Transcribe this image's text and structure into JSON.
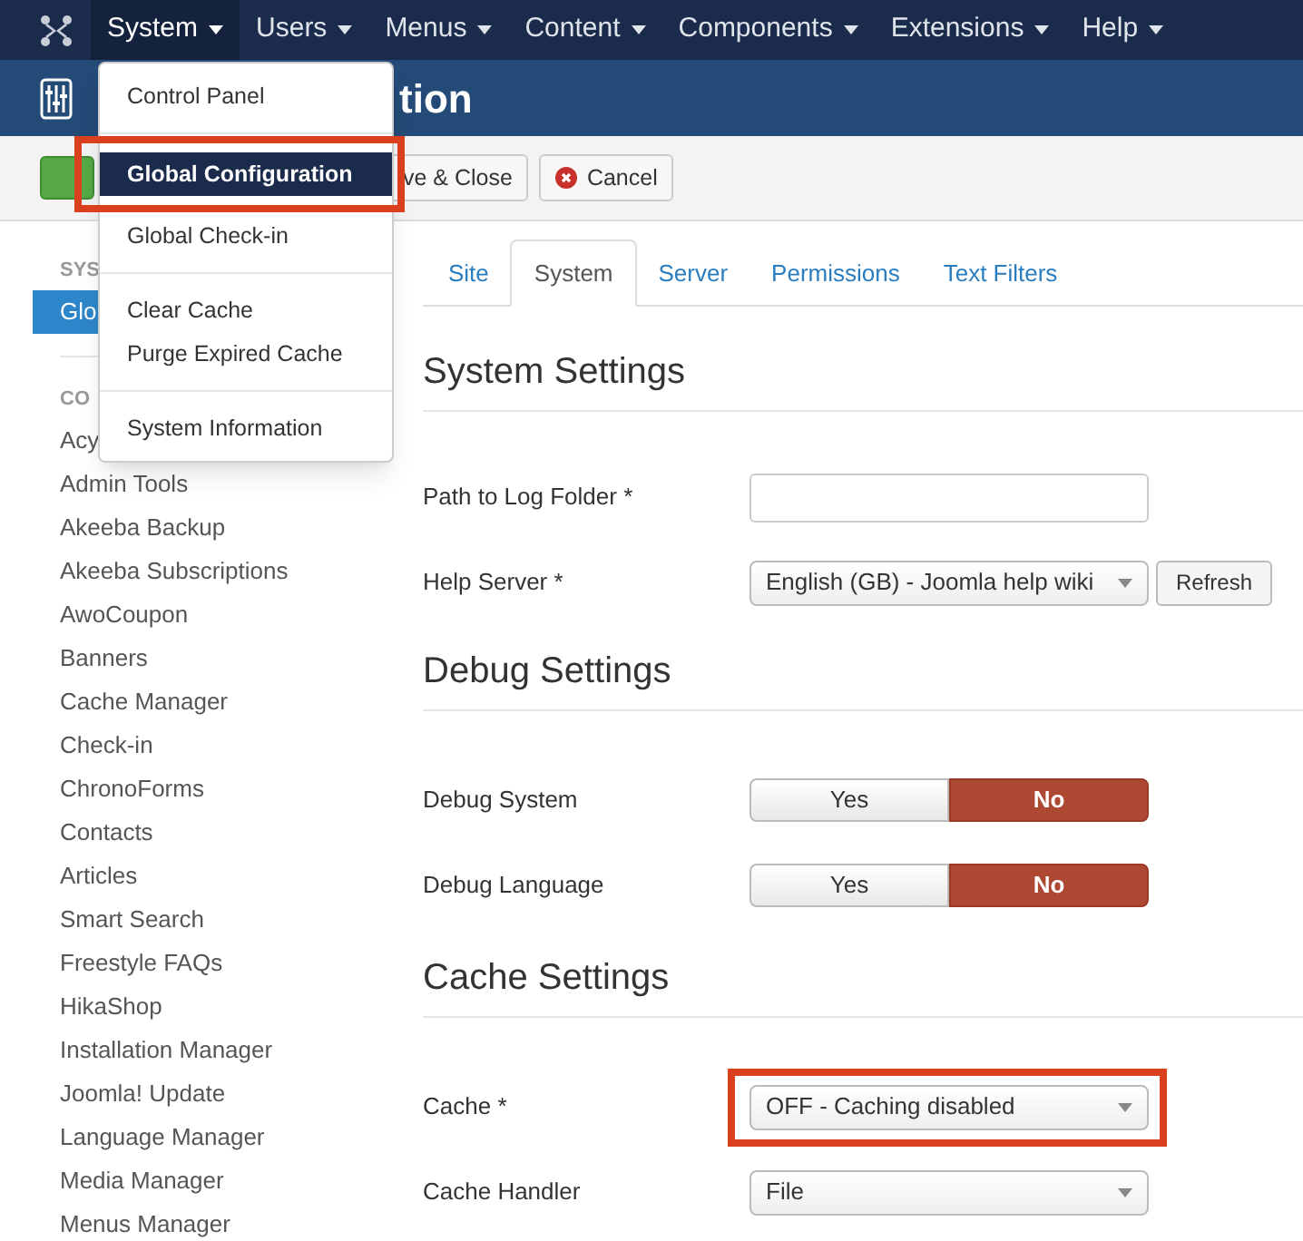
{
  "navbar": {
    "items": [
      {
        "label": "System",
        "selected": true
      },
      {
        "label": "Users",
        "selected": false
      },
      {
        "label": "Menus",
        "selected": false
      },
      {
        "label": "Content",
        "selected": false
      },
      {
        "label": "Components",
        "selected": false
      },
      {
        "label": "Extensions",
        "selected": false
      },
      {
        "label": "Help",
        "selected": false
      }
    ]
  },
  "dropdown": {
    "groups": [
      [
        {
          "label": "Control Panel",
          "selected": false,
          "annotated": false
        }
      ],
      [
        {
          "label": "Global Configuration",
          "selected": true,
          "annotated": true
        },
        {
          "label": "Global Check-in",
          "selected": false,
          "annotated": false
        }
      ],
      [
        {
          "label": "Clear Cache",
          "selected": false,
          "annotated": false
        },
        {
          "label": "Purge Expired Cache",
          "selected": false,
          "annotated": false
        }
      ],
      [
        {
          "label": "System Information",
          "selected": false,
          "annotated": false
        }
      ]
    ]
  },
  "header": {
    "title": "tion"
  },
  "toolbar": {
    "buttons": [
      {
        "kind": "save",
        "label": "ve & Close"
      },
      {
        "kind": "cancel",
        "label": "Cancel"
      }
    ]
  },
  "sidebar": {
    "sections": [
      {
        "heading": "SYS",
        "items": [
          {
            "label": "Glo",
            "selected": true
          }
        ]
      },
      {
        "heading": "CO",
        "items": [
          {
            "label": "Acy",
            "selected": false
          },
          {
            "label": "Admin Tools",
            "selected": false
          },
          {
            "label": "Akeeba Backup",
            "selected": false
          },
          {
            "label": "Akeeba Subscriptions",
            "selected": false
          },
          {
            "label": "AwoCoupon",
            "selected": false
          },
          {
            "label": "Banners",
            "selected": false
          },
          {
            "label": "Cache Manager",
            "selected": false
          },
          {
            "label": "Check-in",
            "selected": false
          },
          {
            "label": "ChronoForms",
            "selected": false
          },
          {
            "label": "Contacts",
            "selected": false
          },
          {
            "label": "Articles",
            "selected": false
          },
          {
            "label": "Smart Search",
            "selected": false
          },
          {
            "label": "Freestyle FAQs",
            "selected": false
          },
          {
            "label": "HikaShop",
            "selected": false
          },
          {
            "label": "Installation Manager",
            "selected": false
          },
          {
            "label": "Joomla! Update",
            "selected": false
          },
          {
            "label": "Language Manager",
            "selected": false
          },
          {
            "label": "Media Manager",
            "selected": false
          },
          {
            "label": "Menus Manager",
            "selected": false
          }
        ]
      }
    ]
  },
  "tabs": [
    {
      "label": "Site",
      "selected": false
    },
    {
      "label": "System",
      "selected": true
    },
    {
      "label": "Server",
      "selected": false
    },
    {
      "label": "Permissions",
      "selected": false
    },
    {
      "label": "Text Filters",
      "selected": false
    }
  ],
  "sections": [
    {
      "title": "System Settings",
      "fields": [
        {
          "kind": "text",
          "label": "Path to Log Folder *"
        },
        {
          "kind": "select_button",
          "label": "Help Server *",
          "value": "English (GB) - Joomla help wiki",
          "button": "Refresh"
        }
      ]
    },
    {
      "title": "Debug Settings",
      "fields": [
        {
          "kind": "toggle",
          "label": "Debug System",
          "options": [
            {
              "label": "Yes",
              "selected": false
            },
            {
              "label": "No",
              "selected": true
            }
          ]
        },
        {
          "kind": "toggle",
          "label": "Debug Language",
          "options": [
            {
              "label": "Yes",
              "selected": false
            },
            {
              "label": "No",
              "selected": true
            }
          ]
        }
      ]
    },
    {
      "title": "Cache Settings",
      "fields": [
        {
          "kind": "select",
          "label": "Cache *",
          "value": "OFF - Caching disabled",
          "annotated": true
        },
        {
          "kind": "select",
          "label": "Cache Handler",
          "value": "File",
          "annotated": false
        }
      ]
    }
  ]
}
